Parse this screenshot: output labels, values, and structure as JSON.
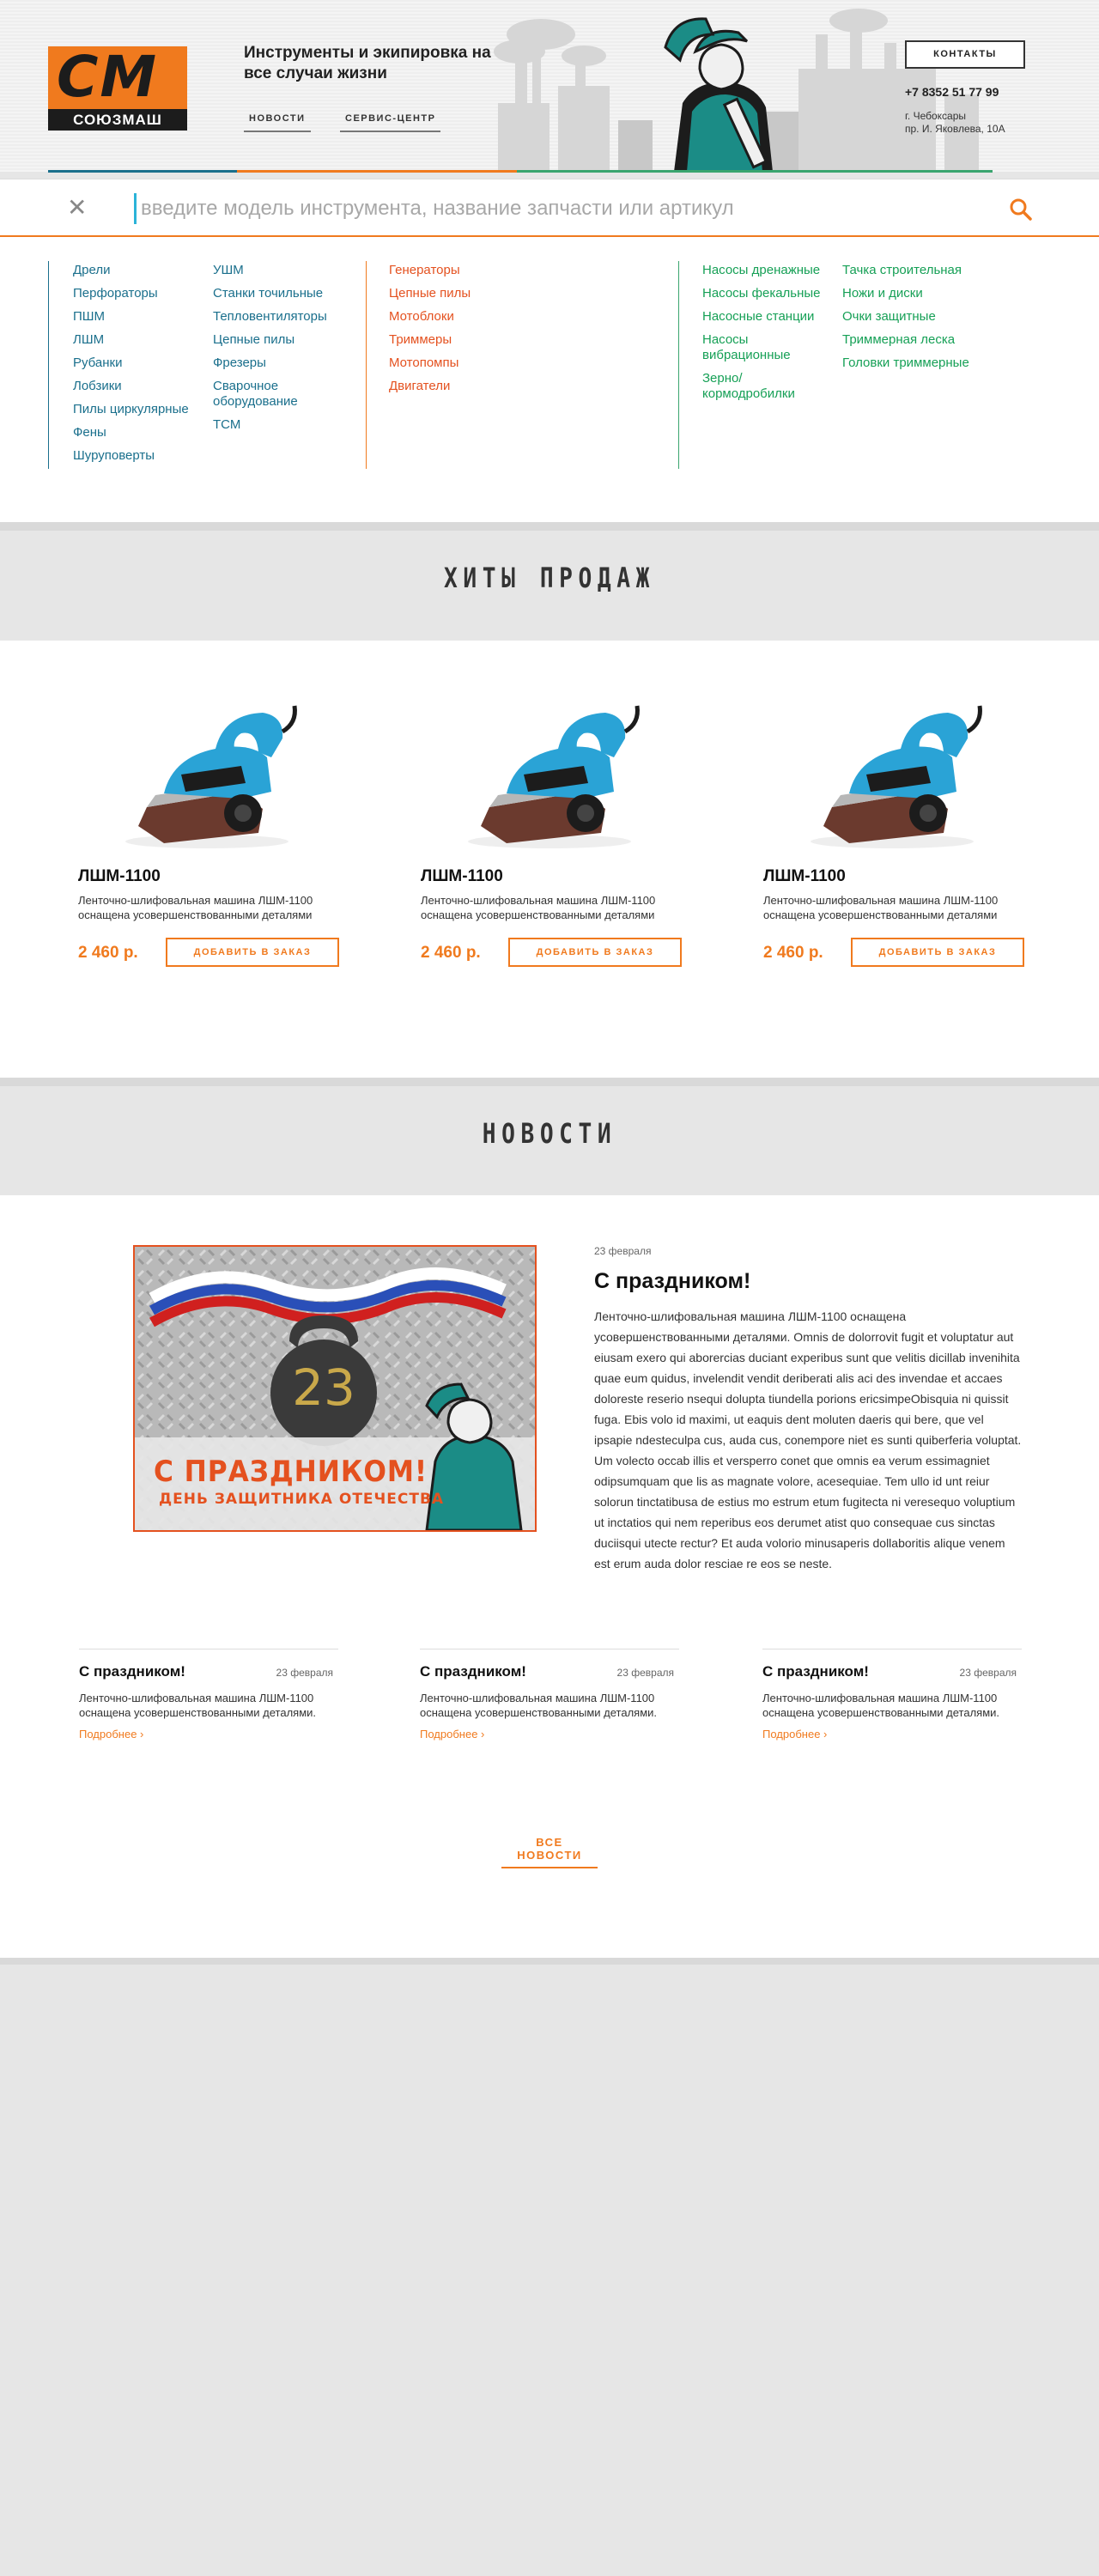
{
  "header": {
    "logo_mark": "СМ",
    "logo_name": "СОЮЗМАШ",
    "tagline": "Инструменты и экипировка на все случаи жизни",
    "nav": [
      "НОВОСТИ",
      "СЕРВИС-ЦЕНТР"
    ],
    "contacts_label": "КОНТАКТЫ",
    "phone": "+7 8352 51 77 99",
    "address_line1": "г. Чебоксары",
    "address_line2": "пр. И. Яковлева, 10А",
    "accent_colors": [
      "#1a6f8c",
      "#f07a1e",
      "#3aa56f"
    ]
  },
  "search": {
    "placeholder": "введите модель инструмента, название запчасти или артикул",
    "close_icon": "close-icon",
    "search_icon": "search-icon"
  },
  "catalog": {
    "group1_col1": [
      "Дрели",
      "Перфораторы",
      "ПШМ",
      "ЛШМ",
      "Рубанки",
      "Лобзики",
      "Пилы циркулярные",
      "Фены",
      "Шуруповерты"
    ],
    "group1_col2": [
      "УШМ",
      "Станки точильные",
      "Тепловентиляторы",
      "Цепные пилы",
      "Фрезеры",
      "Сварочное оборудование",
      "ТСМ"
    ],
    "group2": [
      "Генераторы",
      "Цепные пилы",
      "Мотоблоки",
      "Триммеры",
      "Мотопомпы",
      "Двигатели"
    ],
    "group3_col1": [
      "Насосы дренажные",
      "Насосы фекальные",
      "Насосные станции",
      "Насосы вибрационные",
      "Зерно/ кормодробилки"
    ],
    "group3_col2": [
      "Тачка строительная",
      "Ножи и диски",
      "Очки защитные",
      "Триммерная леска",
      "Головки триммерные"
    ]
  },
  "hits": {
    "title": "ХИТЫ ПРОДАЖ",
    "products": [
      {
        "name": "ЛШМ-1100",
        "desc": "Ленточно-шлифовальная машина ЛШМ-1100 оснащена усовершенствованными деталями",
        "price": "2 460 р.",
        "button": "ДОБАВИТЬ В ЗАКАЗ"
      },
      {
        "name": "ЛШМ-1100",
        "desc": "Ленточно-шлифовальная машина ЛШМ-1100 оснащена усовершенствованными деталями",
        "price": "2 460 р.",
        "button": "ДОБАВИТЬ В ЗАКАЗ"
      },
      {
        "name": "ЛШМ-1100",
        "desc": "Ленточно-шлифовальная машина ЛШМ-1100 оснащена усовершенствованными деталями",
        "price": "2 460 р.",
        "button": "ДОБАВИТЬ В ЗАКАЗ"
      }
    ]
  },
  "news": {
    "title": "НОВОСТИ",
    "banner_title": "С ПРАЗДНИКОМ!",
    "banner_sub": "ДЕНЬ ЗАЩИТНИКА ОТЕЧЕСТВА",
    "banner_number": "23",
    "main": {
      "date": "23 февраля",
      "title": "С праздником!",
      "body": "Ленточно-шлифовальная машина ЛШМ-1100 оснащена усовершенствованными деталями. Omnis de dolorrovit fugit et voluptatur aut eiusam exero qui aborercias duciant experibus sunt que velitis dicillab invenihita quae eum quidus, invelendit vendit deriberati alis aci des invendae et accaes doloreste reserio nsequi dolupta tiundella porions ericsimpeObisquia ni quissit fuga. Ebis volo id maximi, ut eaquis dent moluten daeris qui bere, que vel ipsapie ndesteculpa cus, auda cus, conempore niet es sunti quiberferia voluptat. Um volecto occab illis et versperro conet que omnis ea verum essimagniet odipsumquam que lis as magnate volore, acesequiae. Tem ullo id unt reiur solorun tinctatibusa de estius mo estrum etum fugitecta ni veresequo voluptium ut inctatios qui nem reperibus eos derumet atist quo consequae cus sinctas duciisqui utecte rectur? Et auda volorio minusaperis dollaboritis alique venem est erum auda dolor resciae re eos se neste."
    },
    "items": [
      {
        "title": "С праздником!",
        "date": "23 февраля",
        "desc": "Ленточно-шлифовальная машина ЛШМ-1100 оснащена усовершенствованными деталями.",
        "more": "Подробнее ›"
      },
      {
        "title": "С праздником!",
        "date": "23 февраля",
        "desc": "Ленточно-шлифовальная машина ЛШМ-1100 оснащена усовершенствованными деталями.",
        "more": "Подробнее ›"
      },
      {
        "title": "С праздником!",
        "date": "23 февраля",
        "desc": "Ленточно-шлифовальная машина ЛШМ-1100 оснащена усовершенствованными деталями.",
        "more": "Подробнее ›"
      }
    ],
    "all_label": "ВСЕ НОВОСТИ"
  }
}
